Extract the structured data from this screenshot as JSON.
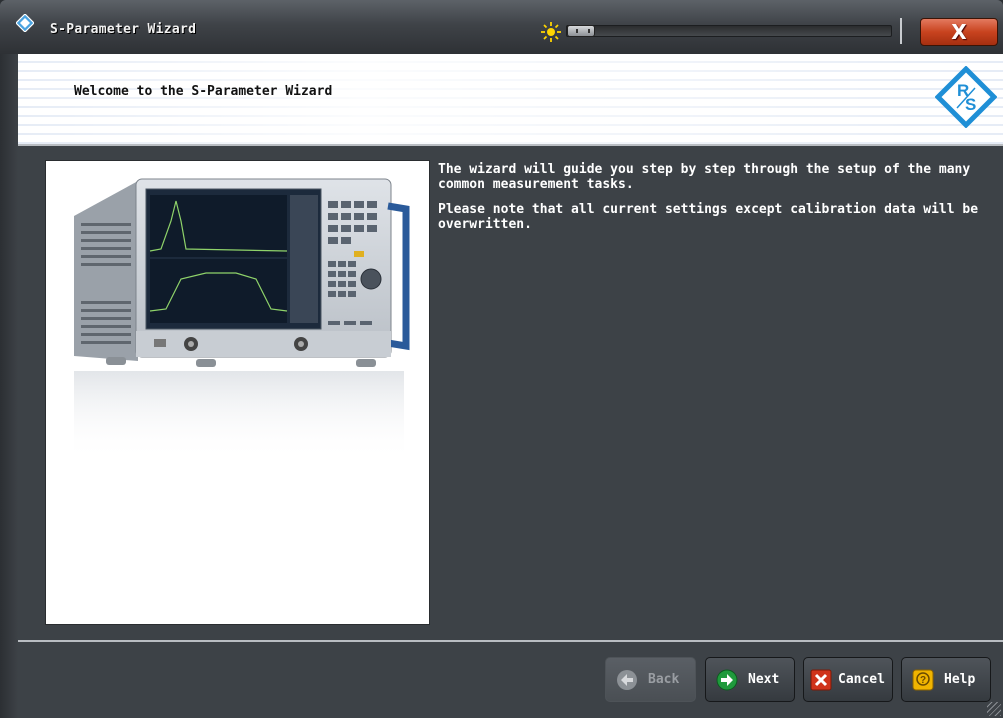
{
  "window": {
    "title": "S-Parameter Wizard",
    "close_label": "X",
    "brightness_slider": {
      "value": 0.0
    }
  },
  "header": {
    "title": "Welcome to the S-Parameter Wizard",
    "logo_text": "RS"
  },
  "content": {
    "paragraphs": [
      "The wizard will guide you step by step through the setup of the many common measurement tasks.",
      "Please note that all current settings except calibration data will be overwritten."
    ]
  },
  "footer": {
    "buttons": [
      {
        "label": "Back",
        "icon": "arrow-left-icon",
        "enabled": false
      },
      {
        "label": "Next",
        "icon": "arrow-right-icon",
        "enabled": true
      },
      {
        "label": "Cancel",
        "icon": "cancel-x-icon",
        "enabled": true
      },
      {
        "label": "Help",
        "icon": "help-icon",
        "enabled": true
      }
    ]
  },
  "colors": {
    "window_bg": "#3d4247",
    "close_button": "#c8431f",
    "next_icon": "#1f9a3c",
    "cancel_icon": "#d0331a",
    "help_icon": "#f0b400",
    "logo_blue": "#1f8fd6"
  }
}
